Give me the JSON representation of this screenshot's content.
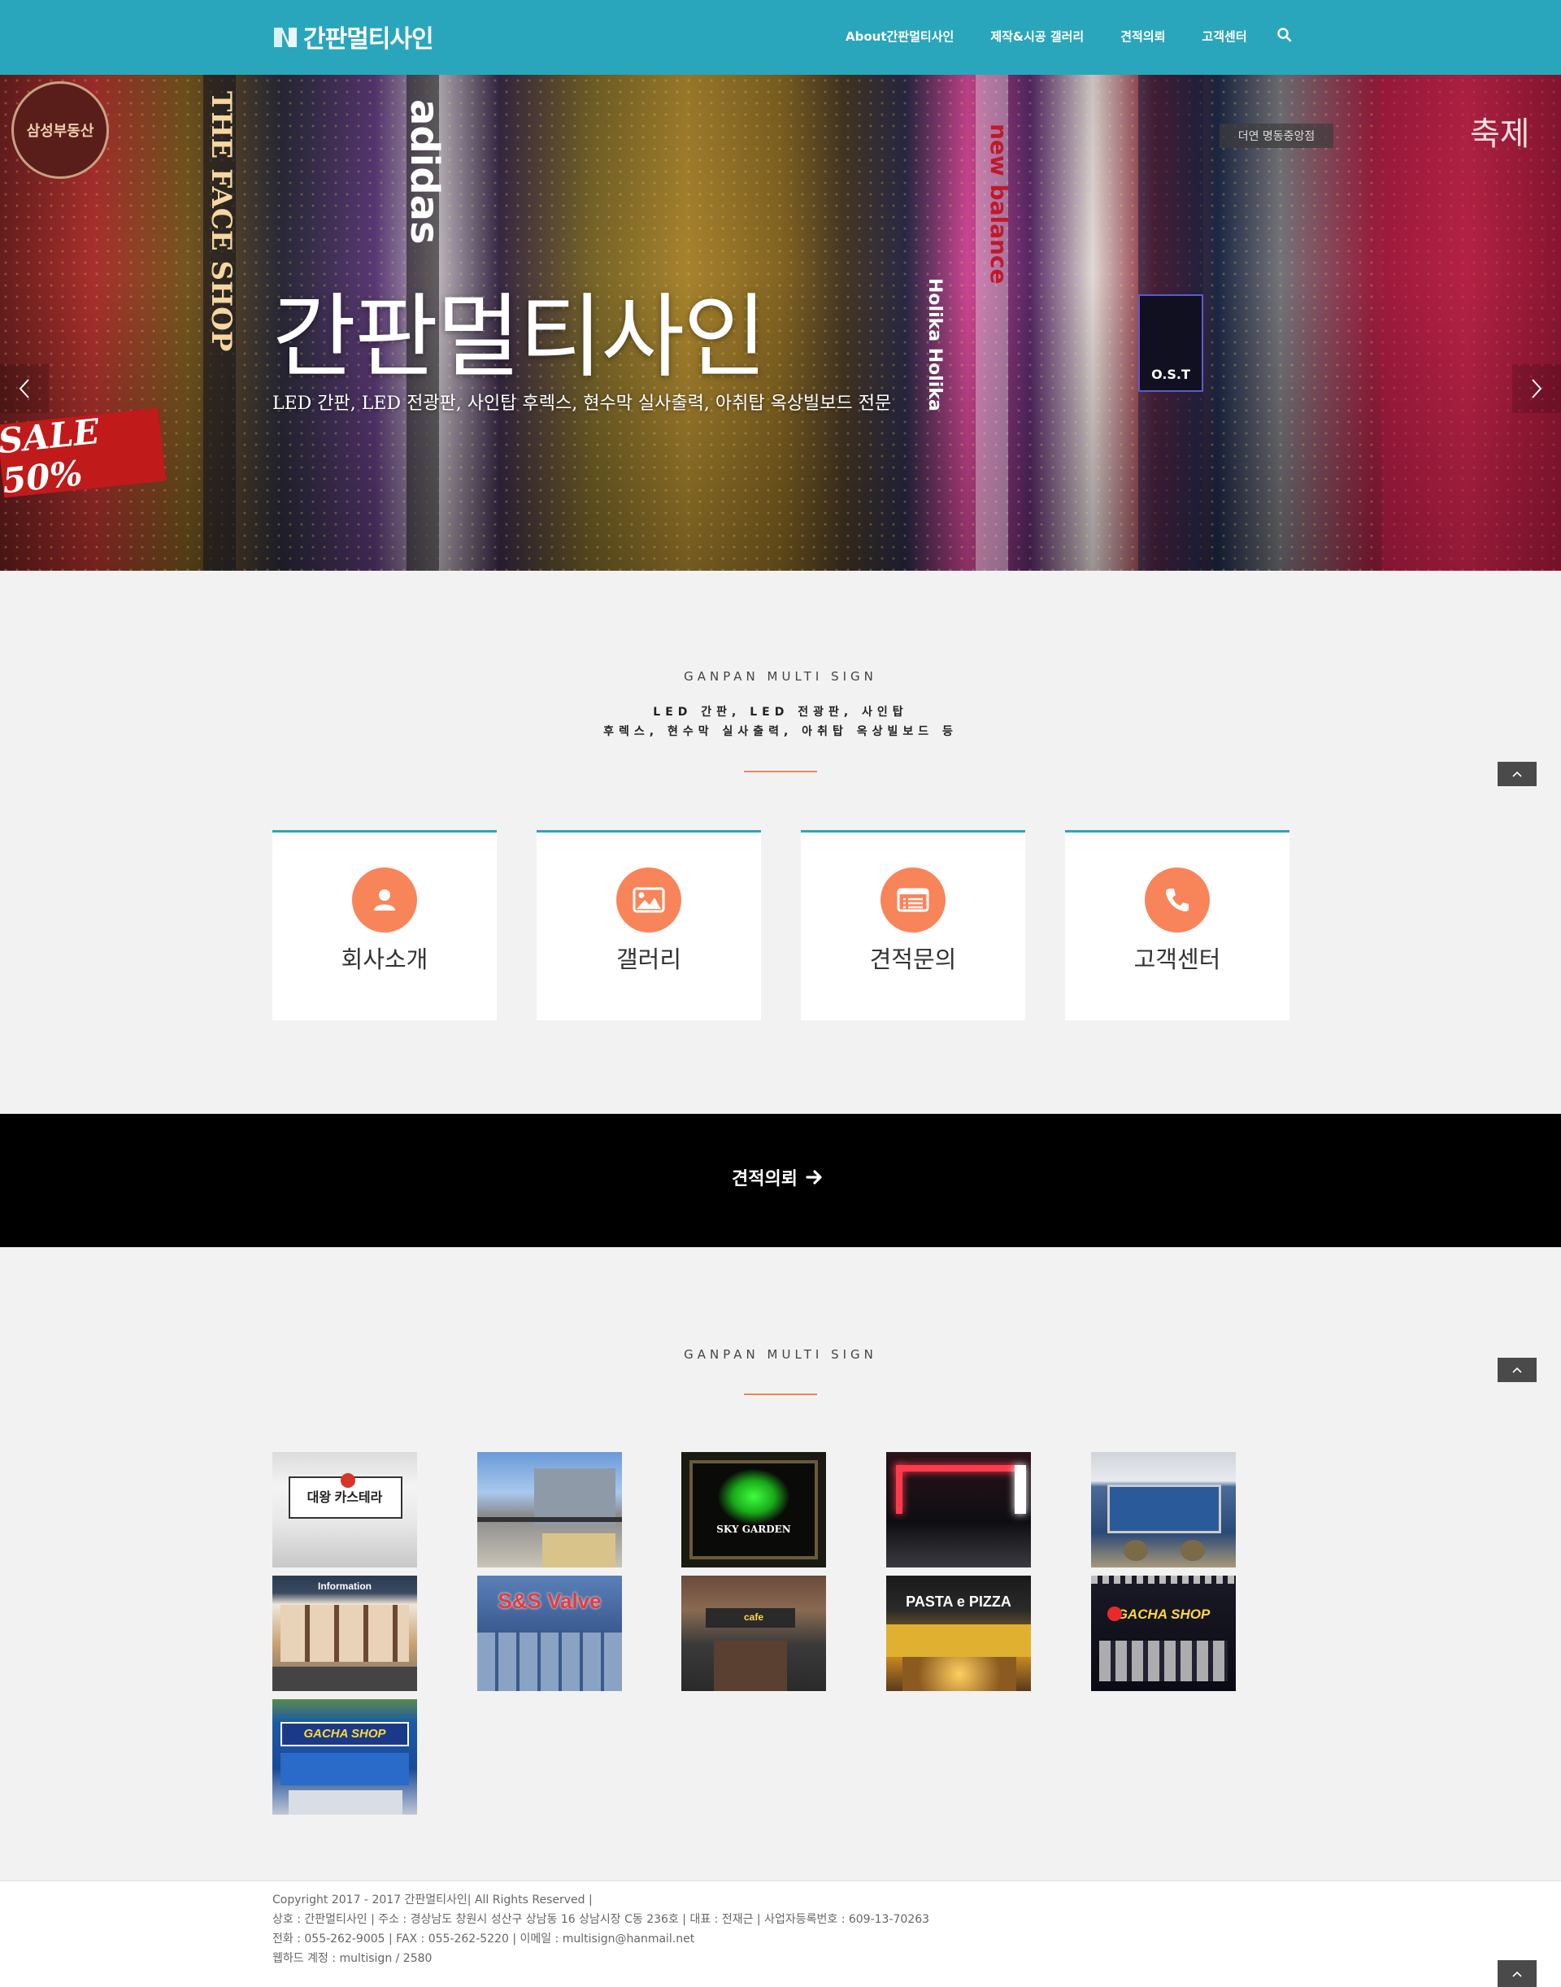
{
  "header": {
    "logo_text": "간판멀티사인",
    "nav": [
      "About간판멀티사인",
      "제작&시공 갤러리",
      "견적의뢰",
      "고객센터"
    ],
    "search_icon": "search-icon",
    "bg_color": "#2aa6bc"
  },
  "hero": {
    "title": "간판멀티사인",
    "subtitle": "LED 간판, LED 전광판, 사인탑 후렉스, 현수막 실사출력, 아취탑 옥상빌보드 전문",
    "sign_texts": [
      "삼성부동산",
      "THE FACE SHOP",
      "adidas",
      "new balance",
      "Holika Holika",
      "SALE 50%",
      "더연 명동중앙점",
      "축제",
      "O.S.T"
    ]
  },
  "intro": {
    "label": "GANPAN MULTI SIGN",
    "line1": "LED 간판, LED 전광판, 사인탑",
    "line2": "후렉스, 현수막 실사출력, 아취탑 옥상빌보드 등"
  },
  "cards": [
    {
      "label": "회사소개",
      "icon": "user-icon"
    },
    {
      "label": "갤러리",
      "icon": "image-icon"
    },
    {
      "label": "견적문의",
      "icon": "list-icon"
    },
    {
      "label": "고객센터",
      "icon": "phone-icon"
    }
  ],
  "cta": {
    "label": "견적의뢰",
    "icon": "arrow-right-icon"
  },
  "gallery": {
    "label": "GANPAN MULTI SIGN",
    "thumbnails": [
      {
        "caption": "대왕 카스테라"
      },
      {
        "caption": ""
      },
      {
        "caption": "SKY GARDEN"
      },
      {
        "caption": ""
      },
      {
        "caption": ""
      },
      {
        "caption": "Information"
      },
      {
        "caption": "S&S Valve"
      },
      {
        "caption": "cafe"
      },
      {
        "caption": "PASTA e PIZZA"
      },
      {
        "caption": "GACHA SHOP"
      },
      {
        "caption": "GACHA SHOP"
      }
    ]
  },
  "footer": {
    "line1": "Copyright 2017 - 2017 간판멀티사인| All Rights Reserved |",
    "line2": "상호 : 간판멀티사인 | 주소 : 경상남도 창원시 성산구 상남동 16 상남시장 C동 236호 | 대표 : 전재근 | 사업자등록번호 : 609-13-70263",
    "line3": "전화 : 055-262-9005 | FAX : 055-262-5220 | 이메일 : multisign@hanmail.net",
    "line4": "웹하드 계정 : multisign / 2580"
  },
  "colors": {
    "accent": "#2aa6bc",
    "orange": "#f8845a",
    "cta_bg": "#000000"
  }
}
